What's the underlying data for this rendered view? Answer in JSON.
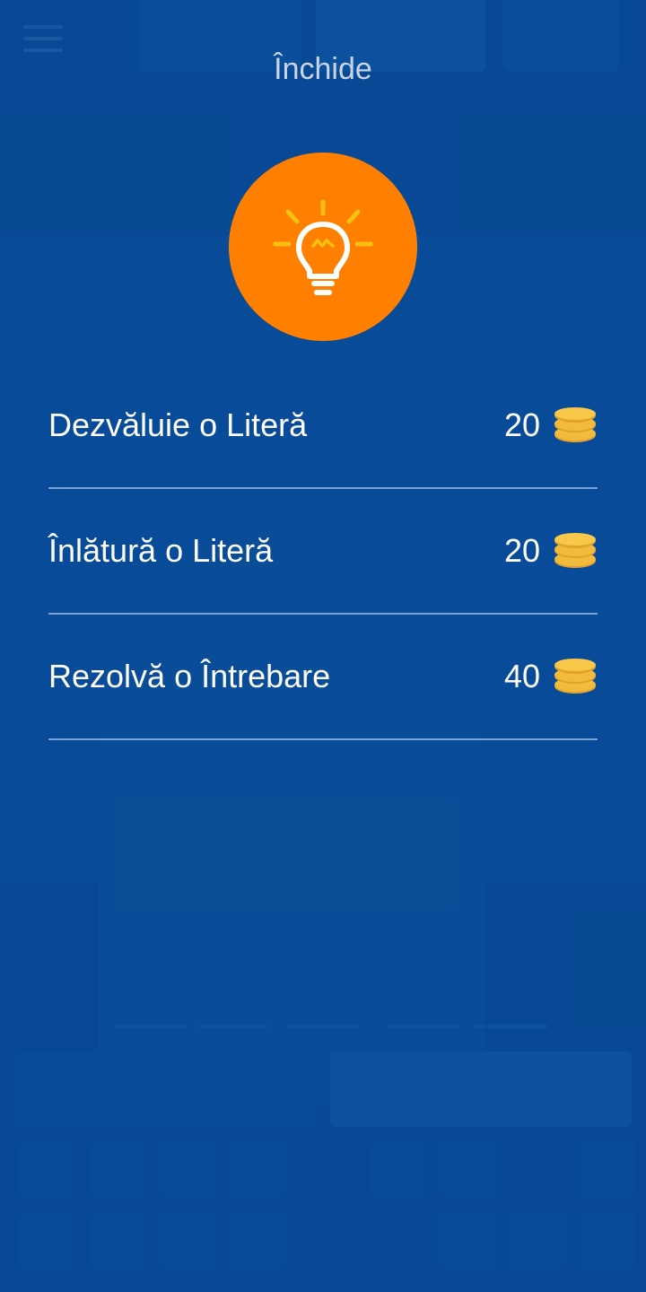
{
  "header": {
    "close_label": "Închide"
  },
  "hint_icon": "lightbulb-icon",
  "colors": {
    "background": "#0a4f97",
    "accent": "#ff8000",
    "coin": "#f2bb3b",
    "text": "#ffffff",
    "close_text": "#c9d4e4"
  },
  "options": [
    {
      "label": "Dezvăluie o Literă",
      "price": "20",
      "icon": "coins-icon"
    },
    {
      "label": "Înlătură o Literă",
      "price": "20",
      "icon": "coins-icon"
    },
    {
      "label": "Rezolvă o Întrebare",
      "price": "40",
      "icon": "coins-icon"
    }
  ]
}
